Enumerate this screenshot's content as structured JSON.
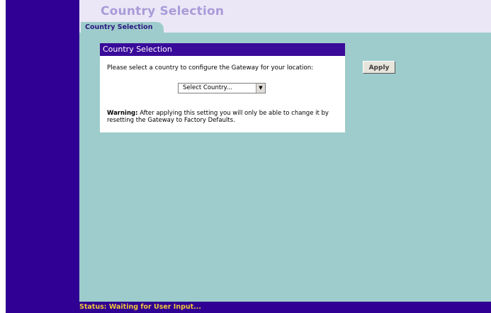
{
  "header": {
    "title": "Country Selection",
    "tab_label": "Country Selection"
  },
  "panel": {
    "title": "Country Selection",
    "prompt": "Please select a country to configure the Gateway for your location:",
    "select_value": "Select Country...",
    "warning_label": "Warning:",
    "warning_text": " After applying this setting you will only be able to change it by resetting the Gateway to Factory Defaults."
  },
  "actions": {
    "apply_label": "Apply"
  },
  "status": {
    "label": "Status: ",
    "text": "Waiting for User Input..."
  },
  "colors": {
    "sidebar": "#2f0093",
    "content_bg": "#9ecccc",
    "panel_header": "#3a0b9a",
    "status_text": "#f0c83c",
    "title_text": "#a99bd8"
  }
}
